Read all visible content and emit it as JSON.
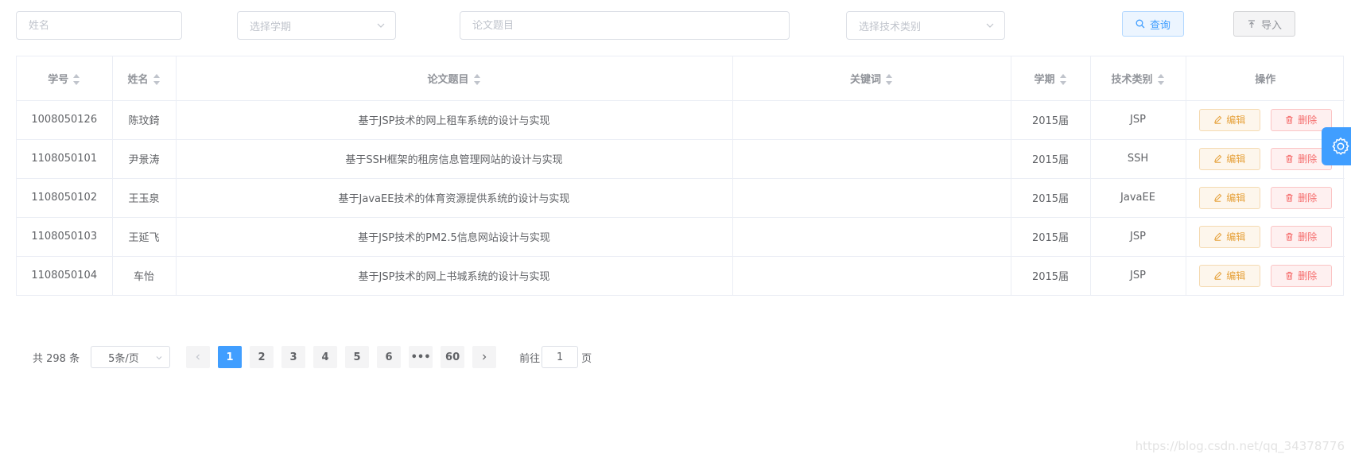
{
  "search": {
    "name_placeholder": "姓名",
    "term_placeholder": "选择学期",
    "title_placeholder": "论文题目",
    "tech_placeholder": "选择技术类别",
    "search_label": "查询",
    "import_label": "导入"
  },
  "table": {
    "headers": [
      "学号",
      "姓名",
      "论文题目",
      "关键词",
      "学期",
      "技术类别",
      "操作"
    ],
    "rows": [
      {
        "id": "1008050126",
        "name": "陈玟錡",
        "title": "基于JSP技术的网上租车系统的设计与实现",
        "keywords": "",
        "term": "2015届",
        "tech": "JSP"
      },
      {
        "id": "1108050101",
        "name": "尹景涛",
        "title": "基于SSH框架的租房信息管理网站的设计与实现",
        "keywords": "",
        "term": "2015届",
        "tech": "SSH"
      },
      {
        "id": "1108050102",
        "name": "王玉泉",
        "title": "基于JavaEE技术的体育资源提供系统的设计与实现",
        "keywords": "",
        "term": "2015届",
        "tech": "JavaEE"
      },
      {
        "id": "1108050103",
        "name": "王延飞",
        "title": "基于JSP技术的PM2.5信息网站设计与实现",
        "keywords": "",
        "term": "2015届",
        "tech": "JSP"
      },
      {
        "id": "1108050104",
        "name": "车怡",
        "title": "基于JSP技术的网上书城系统的设计与实现",
        "keywords": "",
        "term": "2015届",
        "tech": "JSP"
      }
    ],
    "edit_label": "编辑",
    "delete_label": "删除"
  },
  "pagination": {
    "total_text": "共 298 条",
    "page_size": "5条/页",
    "pages": [
      "1",
      "2",
      "3",
      "4",
      "5",
      "6",
      "•••",
      "60"
    ],
    "current_page": "1",
    "goto_prefix": "前往",
    "goto_value": "1",
    "goto_suffix": "页"
  },
  "watermark": "https://blog.csdn.net/qq_34378776",
  "colors": {
    "primary": "#409eff",
    "warning": "#e6a23c",
    "danger": "#f56c6c",
    "border": "#ebeef5"
  },
  "icons": {
    "search": "search-icon",
    "import": "upload-icon",
    "edit": "edit-icon",
    "delete": "trash-icon",
    "settings": "gear-icon"
  }
}
